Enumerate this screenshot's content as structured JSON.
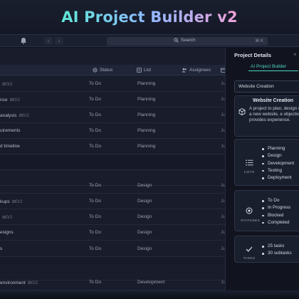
{
  "banner": {
    "title": "AI Project Builder v2"
  },
  "topbar": {
    "search_label": "Search",
    "shortcut": "⌘ K",
    "back_glyph": "‹",
    "forward_glyph": "›"
  },
  "table": {
    "headers": {
      "status": "Status",
      "list": "List",
      "assignees": "Assignees"
    },
    "rows": [
      {
        "name": "",
        "subtasks": "0/2",
        "status": "To Do",
        "list": "Planning",
        "assignee": "Ju"
      },
      {
        "name": "nce",
        "subtasks": "0/2",
        "status": "To Do",
        "list": "Planning",
        "assignee": "Ju"
      },
      {
        "name": "analysis",
        "subtasks": "0/2",
        "status": "To Do",
        "list": "Planning",
        "assignee": "Ju"
      },
      {
        "name": "uirements",
        "subtasks": "",
        "status": "To Do",
        "list": "Planning",
        "assignee": "Ju"
      },
      {
        "name": "d timeline",
        "subtasks": "",
        "status": "To Do",
        "list": "Planning",
        "assignee": "Ju"
      },
      {
        "name": "",
        "subtasks": "",
        "status": "To Do",
        "list": "Design",
        "assignee": "Ju"
      },
      {
        "name": "kups",
        "subtasks": "0/2",
        "status": "To Do",
        "list": "Design",
        "assignee": "Ju"
      },
      {
        "name": "",
        "subtasks": "0/2",
        "status": "To Do",
        "list": "Design",
        "assignee": "Ju"
      },
      {
        "name": "esigns",
        "subtasks": "",
        "status": "To Do",
        "list": "Design",
        "assignee": "Ju"
      },
      {
        "name": "s",
        "subtasks": "",
        "status": "To Do",
        "list": "Design",
        "assignee": "Ju"
      },
      {
        "name": "environment",
        "subtasks": "0/2",
        "status": "To Do",
        "list": "Development",
        "assignee": "Ju"
      }
    ]
  },
  "panel": {
    "title": "Project Details",
    "close_glyph": "×",
    "tab_label": "AI Project Builder",
    "select_value": "Website Creation",
    "project": {
      "title": "Website Creation",
      "description": "A project to plan, design deploy a new website, e objectives and provides experience."
    },
    "lists": {
      "label": "LISTS",
      "items": [
        "Planning",
        "Design",
        "Development",
        "Testing",
        "Deployment"
      ]
    },
    "statuses": {
      "label": "STATUSES",
      "items": [
        "To Do",
        "In Progress",
        "Blocked",
        "Completed"
      ]
    },
    "tasks": {
      "label": "TASKS",
      "items": [
        "25 tasks",
        "30 subtasks"
      ]
    }
  }
}
